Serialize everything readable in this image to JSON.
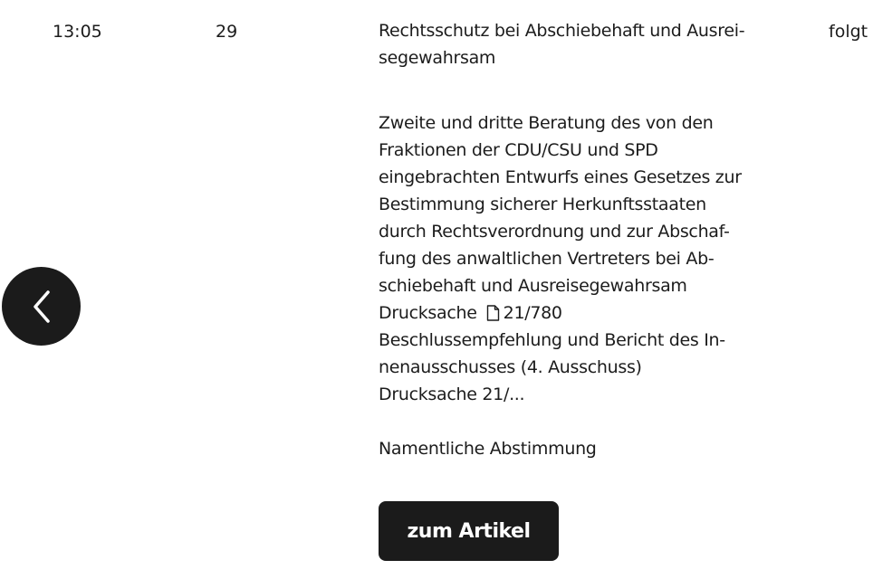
{
  "row": {
    "time": "13:05",
    "top": "29",
    "status": "folgt",
    "title_lines": [
      "Rechtsschutz bei Abschiebehaft und Ausrei-",
      "segewahrsam"
    ],
    "description_lines": [
      "Zweite und dritte Beratung des von den",
      "Fraktionen der CDU/CSU und SPD",
      "eingebrachten Entwurfs eines Gesetzes zur",
      "Bestimmung sicherer Herkunftsstaaten",
      "durch Rechtsverordnung und zur Abschaf-",
      "fung des anwaltlichen Vertreters bei Ab-",
      "schiebehaft und Ausreisegewahrsam"
    ],
    "drucksache_label": "Drucksache",
    "drucksache_number": "21/780",
    "recommendation_lines": [
      "Beschlussempfehlung und Bericht des In-",
      "nenausschusses (4. Ausschuss)",
      "Drucksache 21/..."
    ],
    "vote_note": "Namentliche Abstimmung",
    "cta_label": "zum Artikel"
  },
  "icons": {
    "document": "document-icon",
    "previous": "chevron-left-icon"
  },
  "colors": {
    "button_bg": "#1b1b1b",
    "text": "#1c1c1c",
    "button_text": "#ffffff"
  }
}
